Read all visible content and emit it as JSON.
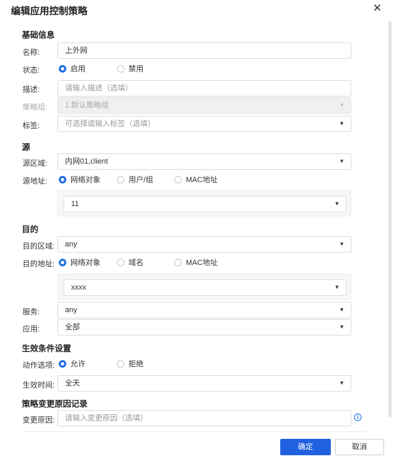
{
  "dialog": {
    "title": "编辑应用控制策略"
  },
  "basic": {
    "heading": "基础信息",
    "name_label": "名称:",
    "name_value": "上外网",
    "status_label": "状态:",
    "status_options": [
      "启用",
      "禁用"
    ],
    "status_selected": "启用",
    "desc_label": "描述:",
    "desc_placeholder": "请输入描述（选填）",
    "policy_group_label": "策略组:",
    "policy_group_value": "1.默认策略组",
    "tag_label": "标签:",
    "tag_placeholder": "可选择或输入标签（选填）"
  },
  "source": {
    "heading": "源",
    "zone_label": "源区域:",
    "zone_value": "内网01,client",
    "address_label": "源地址:",
    "address_options": [
      "网络对象",
      "用户/组",
      "MAC地址"
    ],
    "address_selected": "网络对象",
    "address_object": "11"
  },
  "dest": {
    "heading": "目的",
    "zone_label": "目的区域:",
    "zone_value": "any",
    "address_label": "目的地址:",
    "address_options": [
      "网络对象",
      "域名",
      "MAC地址"
    ],
    "address_selected": "网络对象",
    "address_object": "xxxx",
    "service_label": "服务:",
    "service_value": "any",
    "app_label": "应用:",
    "app_value": "全部"
  },
  "effect": {
    "heading": "生效条件设置",
    "action_label": "动作选项:",
    "action_options": [
      "允许",
      "拒绝"
    ],
    "action_selected": "允许",
    "time_label": "生效时间:",
    "time_value": "全天"
  },
  "change": {
    "heading": "策略变更原因记录",
    "reason_label": "变更原因:",
    "reason_placeholder": "请输入变更原因（选填）"
  },
  "footer": {
    "confirm": "确定",
    "cancel": "取消"
  },
  "icons": {
    "close": "close-icon",
    "caret": "caret-down-icon",
    "info": "info-icon"
  },
  "colors": {
    "accent": "#2161e0",
    "radio_on": "#1f6fe5"
  }
}
